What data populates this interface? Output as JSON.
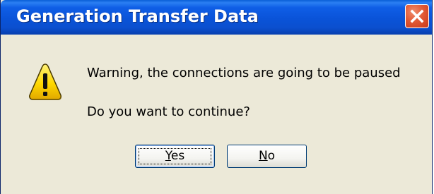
{
  "window": {
    "title": "Generation Transfer Data"
  },
  "titlebar": {
    "close_icon": "close-icon",
    "accent": "#0a53d8",
    "close_color": "#e25a35"
  },
  "message": {
    "icon": "warning-icon",
    "line1": "Warning, the connections are going to be paused",
    "line2": "Do you want to continue?"
  },
  "buttons": {
    "yes_mnemonic": "Y",
    "yes_rest": "es",
    "no_mnemonic": "N",
    "no_rest": "o"
  },
  "colors": {
    "dialog_bg": "#ece9d8",
    "warning_yellow": "#ffd800"
  }
}
